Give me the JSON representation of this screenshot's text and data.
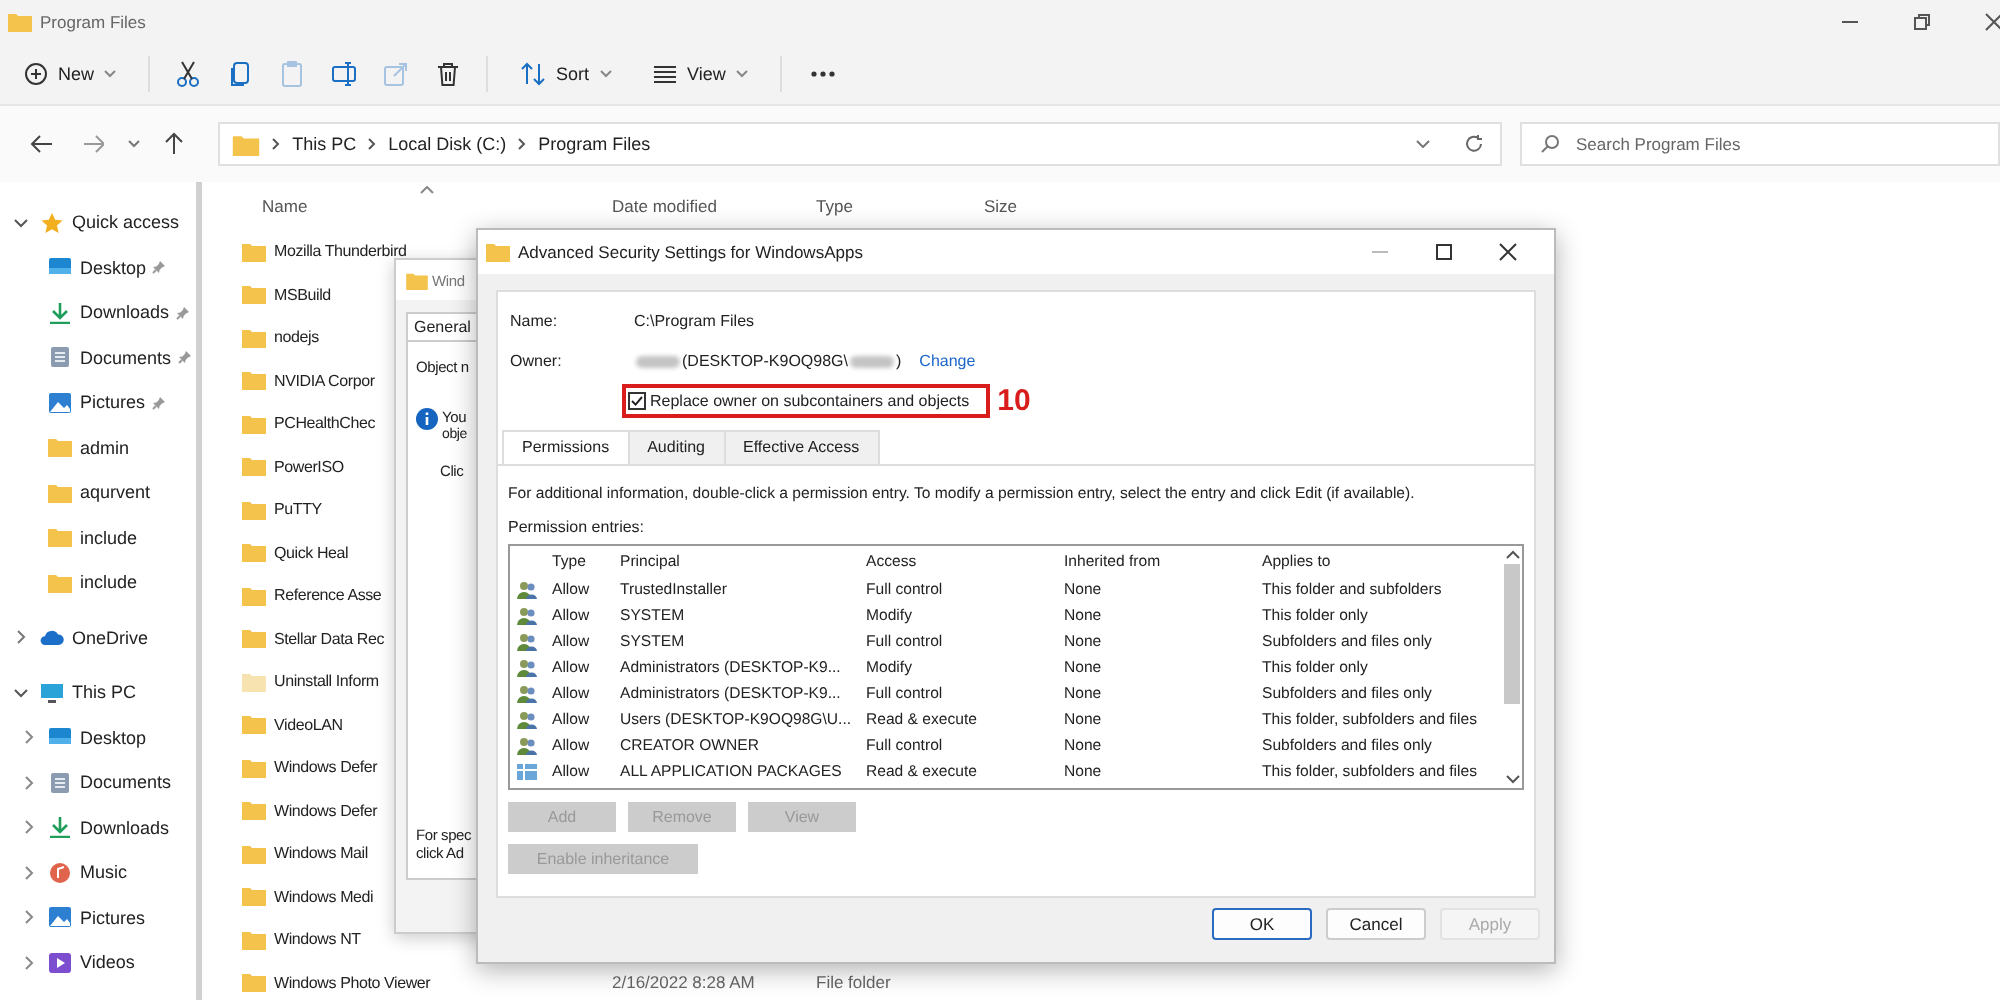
{
  "window": {
    "title": "Program Files"
  },
  "toolbar": {
    "new": "New",
    "tools": [
      {
        "kind": "cut",
        "disabled": false
      },
      {
        "kind": "copy",
        "disabled": false
      },
      {
        "kind": "paste",
        "disabled": true
      },
      {
        "kind": "rename",
        "disabled": false
      },
      {
        "kind": "share",
        "disabled": true
      },
      {
        "kind": "delete",
        "disabled": false
      }
    ],
    "sort": "Sort",
    "view": "View"
  },
  "address": {
    "crumbs": [
      "This PC",
      "Local Disk (C:)",
      "Program Files"
    ],
    "search_placeholder": "Search Program Files"
  },
  "sidebar": {
    "items": [
      {
        "label": "Quick access",
        "kind": "star",
        "expanded": true,
        "children": [
          {
            "label": "Desktop",
            "kind": "desktop",
            "pinned": true
          },
          {
            "label": "Downloads",
            "kind": "download",
            "pinned": true
          },
          {
            "label": "Documents",
            "kind": "document",
            "pinned": true
          },
          {
            "label": "Pictures",
            "kind": "picture",
            "pinned": true
          },
          {
            "label": "admin",
            "kind": "folder",
            "pinned": false
          },
          {
            "label": "aqurvent",
            "kind": "folder",
            "pinned": false
          },
          {
            "label": "include",
            "kind": "folder",
            "pinned": false
          },
          {
            "label": "include",
            "kind": "folder",
            "pinned": false
          }
        ]
      },
      {
        "label": "OneDrive",
        "kind": "cloud",
        "expanded": false
      },
      {
        "label": "This PC",
        "kind": "pc",
        "expanded": true,
        "children": [
          {
            "label": "Desktop",
            "kind": "desktop",
            "expanded": false
          },
          {
            "label": "Documents",
            "kind": "document",
            "expanded": false
          },
          {
            "label": "Downloads",
            "kind": "download",
            "expanded": false
          },
          {
            "label": "Music",
            "kind": "music",
            "expanded": false
          },
          {
            "label": "Pictures",
            "kind": "picture",
            "expanded": false
          },
          {
            "label": "Videos",
            "kind": "video",
            "expanded": false
          }
        ]
      }
    ]
  },
  "files": {
    "columns": [
      "Name",
      "Date modified",
      "Type",
      "Size"
    ],
    "rows": [
      {
        "name": "Mozilla Thunderbird",
        "hidden": false
      },
      {
        "name": "MSBuild",
        "hidden": false
      },
      {
        "name": "nodejs",
        "hidden": false
      },
      {
        "name": "NVIDIA Corpor",
        "hidden": false
      },
      {
        "name": "PCHealthChec",
        "hidden": false
      },
      {
        "name": "PowerISO",
        "hidden": false
      },
      {
        "name": "PuTTY",
        "hidden": false
      },
      {
        "name": "Quick Heal",
        "hidden": false
      },
      {
        "name": "Reference Asse",
        "hidden": false
      },
      {
        "name": "Stellar Data Rec",
        "hidden": false
      },
      {
        "name": "Uninstall Inform",
        "hidden": true
      },
      {
        "name": "VideoLAN",
        "hidden": false
      },
      {
        "name": "Windows Defer",
        "hidden": false
      },
      {
        "name": "Windows Defer",
        "hidden": false
      },
      {
        "name": "Windows Mail",
        "hidden": false
      },
      {
        "name": "Windows Medi",
        "hidden": false
      },
      {
        "name": "Windows NT",
        "hidden": false
      },
      {
        "name": "Windows Photo Viewer",
        "date": "2/16/2022 8:28 AM",
        "type": "File folder",
        "hidden": false
      }
    ]
  },
  "back_dialog": {
    "title": "Wind",
    "tab": "General",
    "object_label": "Object n",
    "info": [
      "You",
      "obje"
    ],
    "hint": "Clic",
    "footer": [
      "For spec",
      "click Ad"
    ]
  },
  "dialog": {
    "title": "Advanced Security Settings for WindowsApps",
    "name_label": "Name:",
    "name": "C:\\Program Files",
    "owner_label": "Owner:",
    "owner": "(DESKTOP-K9OQ98G\\",
    "owner_end": ")",
    "change": "Change",
    "replace_owner": {
      "label": "Replace owner on subcontainers and objects",
      "checked": true
    },
    "callout": "10",
    "tabs": [
      {
        "label": "Permissions",
        "selected": true
      },
      {
        "label": "Auditing",
        "selected": false
      },
      {
        "label": "Effective Access",
        "selected": false
      }
    ],
    "info": "For additional information, double-click a permission entry. To modify a permission entry, select the entry and click Edit (if available).",
    "entries_label": "Permission entries:",
    "columns": [
      "Type",
      "Principal",
      "Access",
      "Inherited from",
      "Applies to"
    ],
    "rows": [
      {
        "kind": "users",
        "cells": [
          "Allow",
          "TrustedInstaller",
          "Full control",
          "None",
          "This folder and subfolders"
        ]
      },
      {
        "kind": "users",
        "cells": [
          "Allow",
          "SYSTEM",
          "Modify",
          "None",
          "This folder only"
        ]
      },
      {
        "kind": "users",
        "cells": [
          "Allow",
          "SYSTEM",
          "Full control",
          "None",
          "Subfolders and files only"
        ]
      },
      {
        "kind": "users",
        "cells": [
          "Allow",
          "Administrators (DESKTOP-K9...",
          "Modify",
          "None",
          "This folder only"
        ]
      },
      {
        "kind": "users",
        "cells": [
          "Allow",
          "Administrators (DESKTOP-K9...",
          "Full control",
          "None",
          "Subfolders and files only"
        ]
      },
      {
        "kind": "users",
        "cells": [
          "Allow",
          "Users (DESKTOP-K9OQ98G\\U...",
          "Read & execute",
          "None",
          "This folder, subfolders and files"
        ]
      },
      {
        "kind": "users",
        "cells": [
          "Allow",
          "CREATOR OWNER",
          "Full control",
          "None",
          "Subfolders and files only"
        ]
      },
      {
        "kind": "package",
        "cells": [
          "Allow",
          "ALL APPLICATION PACKAGES",
          "Read & execute",
          "None",
          "This folder, subfolders and files"
        ]
      }
    ],
    "buttons": [
      {
        "label": "Add",
        "disabled": true
      },
      {
        "label": "Remove",
        "disabled": true
      },
      {
        "label": "View",
        "disabled": true
      }
    ],
    "enable_inheritance": {
      "label": "Enable inheritance",
      "disabled": true
    },
    "footer_buttons": [
      {
        "label": "OK",
        "default": true,
        "disabled": false
      },
      {
        "label": "Cancel",
        "default": false,
        "disabled": false
      },
      {
        "label": "Apply",
        "default": false,
        "disabled": true
      }
    ]
  }
}
